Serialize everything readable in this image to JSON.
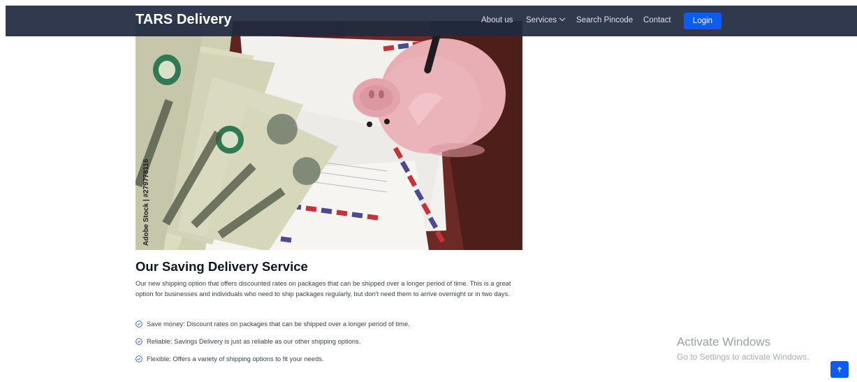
{
  "navbar": {
    "brand": "TARS Delivery",
    "links": [
      "About us",
      "Services",
      "Search Pincode",
      "Contact"
    ],
    "login_label": "Login"
  },
  "content": {
    "title": "Our Saving Delivery Service",
    "description": "Our new shipping option that offers discounted rates on packages that can be shipped over a longer period of time. This is a great option for businesses and individuals who need to ship packages regularly, but don't need them to arrive overnight or in two days.",
    "features": [
      "Save money: Discount rates on packages that can be shipped over a longer period of time.",
      "Reliable: Savings Delivery is just as reliable as our other shipping options.",
      "Flexible: Offers a variety of shipping options to fit your needs."
    ]
  },
  "hero_image": {
    "watermark": "Adobe Stock | #279778116"
  },
  "windows_watermark": {
    "title": "Activate Windows",
    "subtitle": "Go to Settings to activate Windows."
  },
  "colors": {
    "navbar_bg": "#202a40",
    "accent": "#0d5cf2",
    "check_icon": "#2a5fd6"
  },
  "icons": {
    "feature_icon": "check-circle-icon",
    "back_to_top": "arrow-up-icon"
  }
}
